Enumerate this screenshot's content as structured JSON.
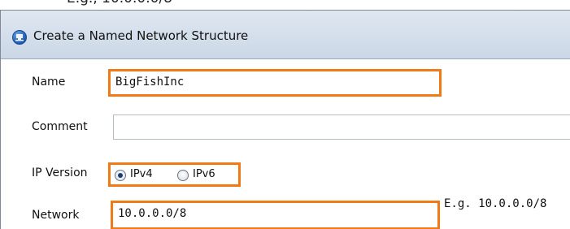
{
  "clipped_top_text": "E.g., 10.0.0.0/8",
  "dialog": {
    "title": "Create a Named Network Structure",
    "icon": "network-globe-icon"
  },
  "form": {
    "name_label": "Name",
    "name_value": "BigFishInc",
    "comment_label": "Comment",
    "comment_value": "",
    "ip_version_label": "IP Version",
    "ip_options": [
      {
        "label": "IPv4",
        "selected": true
      },
      {
        "label": "IPv6",
        "selected": false
      }
    ],
    "network_label": "Network",
    "network_value": "10.0.0.0/8",
    "network_hint": "E.g. 10.0.0.0/8"
  },
  "colors": {
    "highlight": "#f07a16",
    "titlebar": "#d5dfec"
  }
}
